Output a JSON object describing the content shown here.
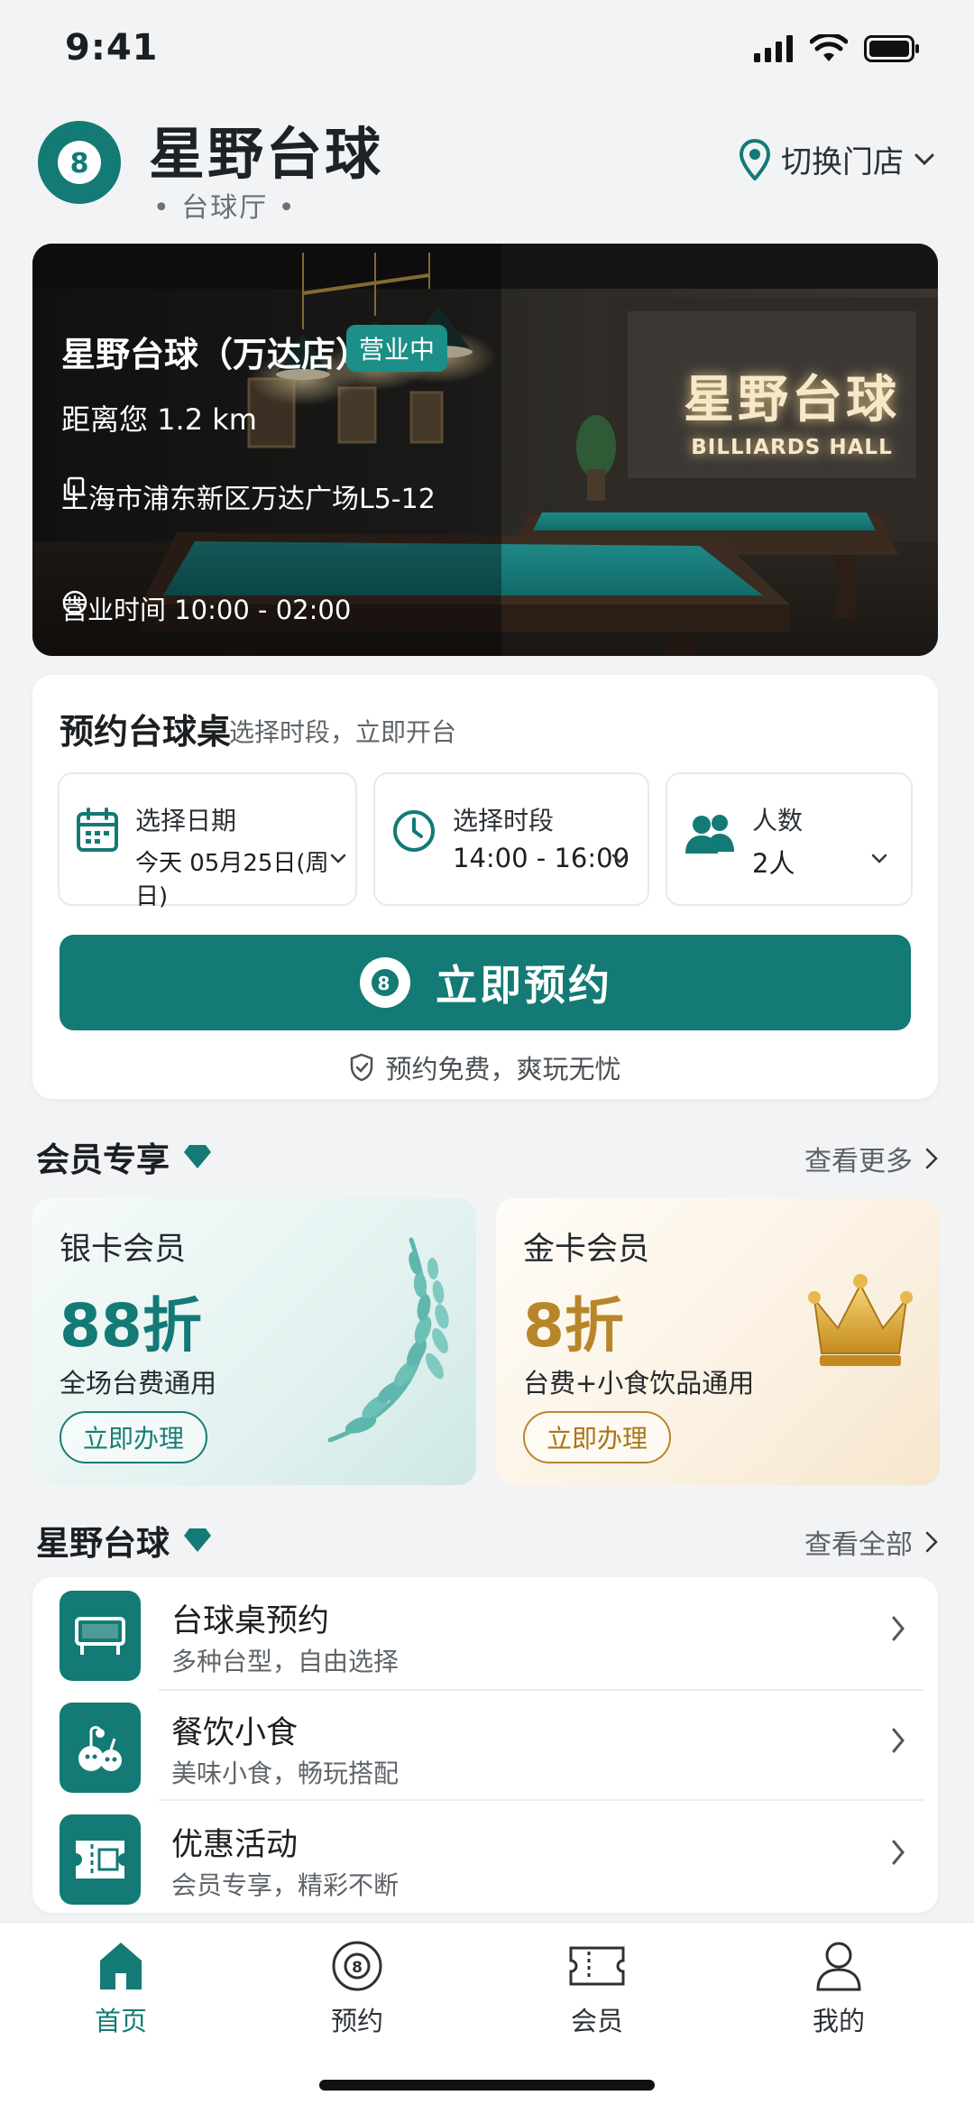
{
  "status_bar": {
    "time": "9:41"
  },
  "header": {
    "brand_name": "星野台球",
    "brand_subtitle": "• 台球厅 •",
    "switch_store_label": "切换门店"
  },
  "hero": {
    "store_name": "星野台球（万达店）",
    "status_badge": "营业中",
    "distance": "距离您 1.2 km",
    "address": "上海市浦东新区万达广场L5-12",
    "hours": "营业时间 10:00 - 02:00",
    "sign_cn": "星野台球",
    "sign_en": "BILLIARDS HALL"
  },
  "booking": {
    "title": "预约台球桌",
    "subtitle": "选择时段，立即开台",
    "date": {
      "label": "选择日期",
      "value": "今天 05月25日(周日)"
    },
    "time": {
      "label": "选择时段",
      "value": "14:00 - 16:00"
    },
    "people": {
      "label": "人数",
      "value": "2人"
    },
    "button_label": "立即预约",
    "note": "预约免费，爽玩无忧"
  },
  "membership": {
    "title": "会员专享",
    "more_label": "查看更多",
    "cards": [
      {
        "name": "银卡会员",
        "discount": "88折",
        "desc": "全场台费通用",
        "button": "立即办理",
        "accent": "#137a75"
      },
      {
        "name": "金卡会员",
        "discount": "8折",
        "desc": "台费+小食饮品通用",
        "button": "立即办理",
        "accent": "#b8862a"
      }
    ]
  },
  "services": {
    "title": "星野台球",
    "more_label": "查看全部",
    "items": [
      {
        "title": "台球桌预约",
        "subtitle": "多种台型，自由选择",
        "icon": "billiard-table-icon"
      },
      {
        "title": "餐饮小食",
        "subtitle": "美味小食，畅玩搭配",
        "icon": "food-icon"
      },
      {
        "title": "优惠活动",
        "subtitle": "会员专享，精彩不断",
        "icon": "ticket-icon"
      }
    ]
  },
  "tabbar": {
    "tabs": [
      {
        "label": "首页",
        "icon": "home-icon",
        "active": true
      },
      {
        "label": "预约",
        "icon": "billiard-ball-icon",
        "active": false
      },
      {
        "label": "会员",
        "icon": "card-icon",
        "active": false
      },
      {
        "label": "我的",
        "icon": "user-icon",
        "active": false
      }
    ]
  },
  "colors": {
    "primary": "#137a75",
    "gold": "#b8862a",
    "background": "#f2f3f5"
  }
}
